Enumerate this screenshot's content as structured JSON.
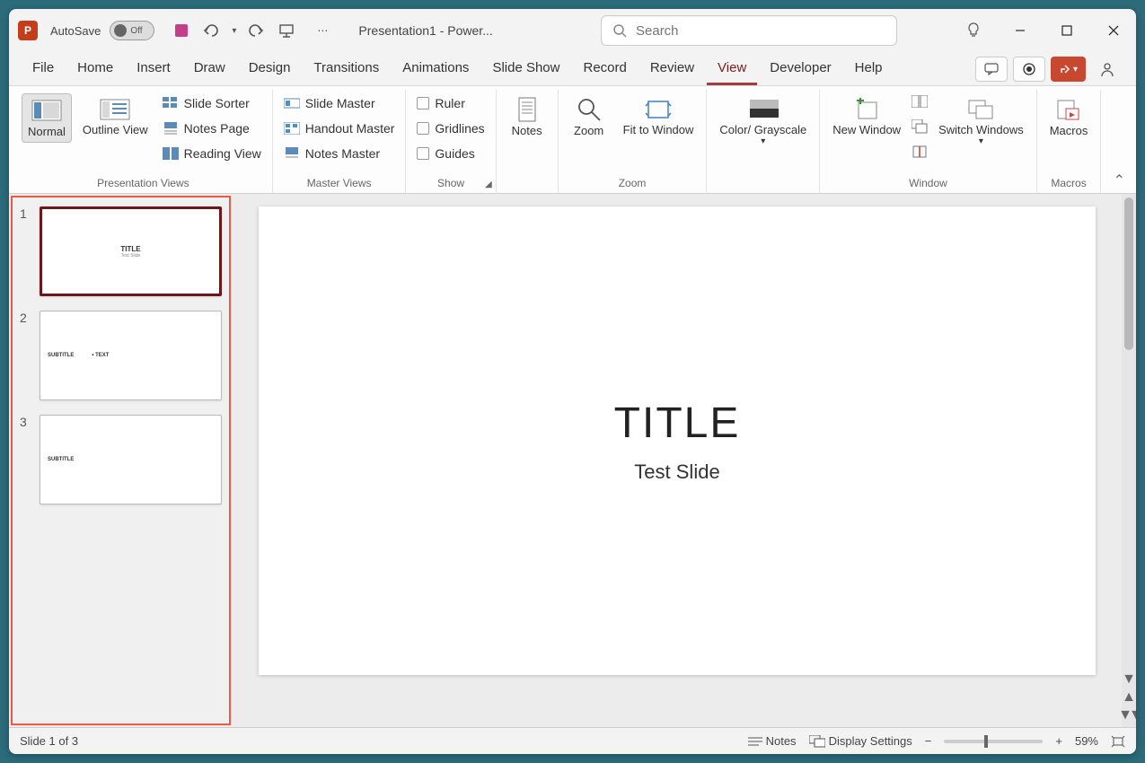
{
  "titlebar": {
    "autosave_label": "AutoSave",
    "autosave_state": "Off",
    "title": "Presentation1  -  Power...",
    "search_placeholder": "Search"
  },
  "tabs": {
    "file": "File",
    "home": "Home",
    "insert": "Insert",
    "draw": "Draw",
    "design": "Design",
    "transitions": "Transitions",
    "animations": "Animations",
    "slideshow": "Slide Show",
    "record": "Record",
    "review": "Review",
    "view": "View",
    "developer": "Developer",
    "help": "Help"
  },
  "ribbon": {
    "presentation_views": {
      "label": "Presentation Views",
      "normal": "Normal",
      "outline": "Outline View",
      "slide_sorter": "Slide Sorter",
      "notes_page": "Notes Page",
      "reading_view": "Reading View"
    },
    "master_views": {
      "label": "Master Views",
      "slide_master": "Slide Master",
      "handout_master": "Handout Master",
      "notes_master": "Notes Master"
    },
    "show": {
      "label": "Show",
      "ruler": "Ruler",
      "gridlines": "Gridlines",
      "guides": "Guides"
    },
    "notes": "Notes",
    "zoom_group": {
      "label": "Zoom",
      "zoom": "Zoom",
      "fit": "Fit to Window"
    },
    "color": {
      "label": "Color/ Grayscale"
    },
    "window": {
      "label": "Window",
      "new_window": "New Window",
      "switch": "Switch Windows"
    },
    "macros": {
      "label": "Macros",
      "btn": "Macros"
    }
  },
  "thumbnails": [
    {
      "num": "1",
      "title": "TITLE",
      "sub": "Test Slide",
      "selected": true,
      "layout": "title"
    },
    {
      "num": "2",
      "title": "SUBTITLE",
      "sub": "• TEXT",
      "selected": false,
      "layout": "content"
    },
    {
      "num": "3",
      "title": "SUBTITLE",
      "sub": "",
      "selected": false,
      "layout": "content"
    }
  ],
  "slide": {
    "title": "TITLE",
    "subtitle": "Test Slide"
  },
  "statusbar": {
    "slide_info": "Slide 1 of 3",
    "notes": "Notes",
    "display": "Display Settings",
    "zoom": "59%"
  }
}
